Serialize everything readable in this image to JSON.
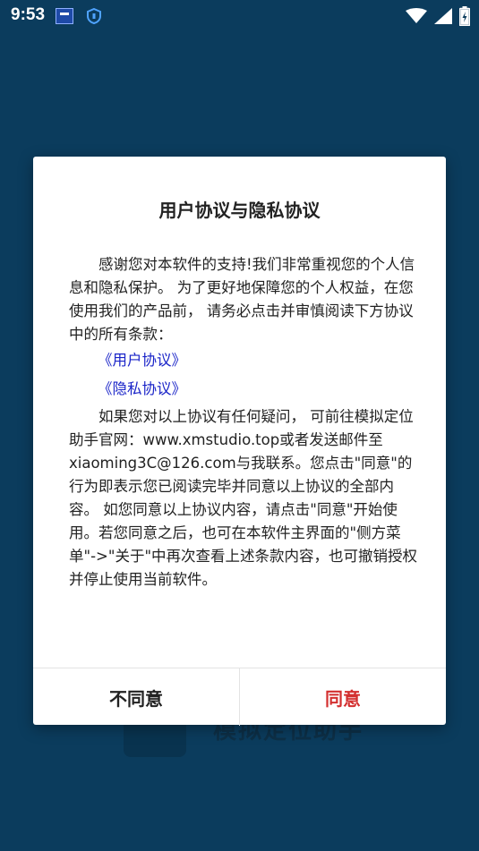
{
  "status_bar": {
    "time": "9:53",
    "icons": [
      "notification-app-icon",
      "shield-icon",
      "wifi-icon",
      "signal-icon",
      "battery-charging-icon"
    ]
  },
  "background_app": {
    "name": "模拟定位助手"
  },
  "dialog": {
    "title": "用户协议与隐私协议",
    "intro": "感谢您对本软件的支持!我们非常重视您的个人信息和隐私保护。 为了更好地保障您的个人权益，在您使用我们的产品前， 请务必点击并审慎阅读下方协议中的所有条款：",
    "links": {
      "user_agreement": "《用户协议》",
      "privacy_agreement": "《隐私协议》"
    },
    "body": "如果您对以上协议有任何疑问， 可前往模拟定位助手官网：www.xmstudio.top或者发送邮件至xiaoming3C@126.com与我联系。您点击\"同意\"的行为即表示您已阅读完毕并同意以上协议的全部内容。 如您同意以上协议内容，请点击\"同意\"开始使用。若您同意之后，也可在本软件主界面的\"侧方菜单\"->\"关于\"中再次查看上述条款内容，也可撤销授权并停止使用当前软件。",
    "buttons": {
      "disagree": "不同意",
      "agree": "同意"
    }
  },
  "colors": {
    "background": "#0b3c5d",
    "link": "#1a24c8",
    "agree": "#d32f2f"
  }
}
